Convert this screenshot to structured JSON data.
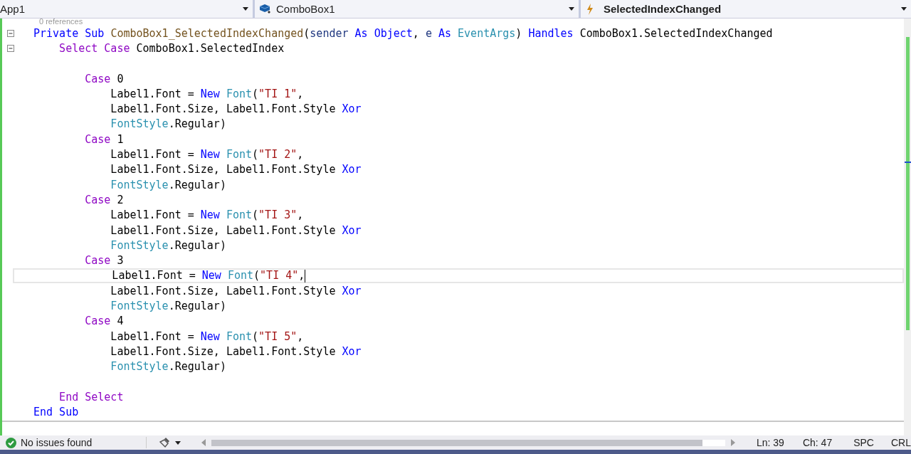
{
  "nav_bar": {
    "project": "App1",
    "object": "ComboBox1",
    "event": "SelectedIndexChanged"
  },
  "code_lens": "0 references",
  "lines": [
    {
      "kind": "code",
      "foldable": true,
      "current": false,
      "tokens": [
        {
          "text": "Private Sub ",
          "kind": "keyword"
        },
        {
          "text": "ComboBox1_SelectedIndexChanged",
          "kind": "method"
        },
        {
          "text": "(",
          "kind": "plain"
        },
        {
          "text": "sender",
          "kind": "param"
        },
        {
          "text": " As Object",
          "kind": "keyword"
        },
        {
          "text": ", ",
          "kind": "plain"
        },
        {
          "text": "e",
          "kind": "param"
        },
        {
          "text": " As ",
          "kind": "keyword"
        },
        {
          "text": "EventArgs",
          "kind": "type"
        },
        {
          "text": ") ",
          "kind": "plain"
        },
        {
          "text": "Handles",
          "kind": "keyword"
        },
        {
          "text": " ComboBox1.SelectedIndexChanged",
          "kind": "plain"
        }
      ]
    },
    {
      "kind": "code",
      "foldable": true,
      "current": false,
      "tokens": [
        {
          "text": "    Select Case",
          "kind": "control"
        },
        {
          "text": " ComboBox1.SelectedIndex",
          "kind": "plain"
        }
      ]
    },
    {
      "kind": "blank",
      "foldable": false,
      "current": false
    },
    {
      "kind": "code",
      "foldable": false,
      "current": false,
      "tokens": [
        {
          "text": "        Case",
          "kind": "control"
        },
        {
          "text": " 0",
          "kind": "plain"
        }
      ]
    },
    {
      "kind": "code",
      "foldable": false,
      "current": false,
      "tokens": [
        {
          "text": "            Label1.Font = ",
          "kind": "plain"
        },
        {
          "text": "New ",
          "kind": "keyword"
        },
        {
          "text": "Font",
          "kind": "type"
        },
        {
          "text": "(",
          "kind": "plain"
        },
        {
          "text": "\"TI 1\"",
          "kind": "string"
        },
        {
          "text": ",",
          "kind": "plain"
        }
      ]
    },
    {
      "kind": "code",
      "foldable": false,
      "current": false,
      "tokens": [
        {
          "text": "            Label1.Font.Size, Label1.Font.Style ",
          "kind": "plain"
        },
        {
          "text": "Xor",
          "kind": "keyword"
        }
      ]
    },
    {
      "kind": "code",
      "foldable": false,
      "current": false,
      "tokens": [
        {
          "text": "            FontStyle",
          "kind": "type"
        },
        {
          "text": ".Regular)",
          "kind": "plain"
        }
      ]
    },
    {
      "kind": "code",
      "foldable": false,
      "current": false,
      "tokens": [
        {
          "text": "        Case",
          "kind": "control"
        },
        {
          "text": " 1",
          "kind": "plain"
        }
      ]
    },
    {
      "kind": "code",
      "foldable": false,
      "current": false,
      "tokens": [
        {
          "text": "            Label1.Font = ",
          "kind": "plain"
        },
        {
          "text": "New ",
          "kind": "keyword"
        },
        {
          "text": "Font",
          "kind": "type"
        },
        {
          "text": "(",
          "kind": "plain"
        },
        {
          "text": "\"TI 2\"",
          "kind": "string"
        },
        {
          "text": ",",
          "kind": "plain"
        }
      ]
    },
    {
      "kind": "code",
      "foldable": false,
      "current": false,
      "tokens": [
        {
          "text": "            Label1.Font.Size, Label1.Font.Style ",
          "kind": "plain"
        },
        {
          "text": "Xor",
          "kind": "keyword"
        }
      ]
    },
    {
      "kind": "code",
      "foldable": false,
      "current": false,
      "tokens": [
        {
          "text": "            FontStyle",
          "kind": "type"
        },
        {
          "text": ".Regular)",
          "kind": "plain"
        }
      ]
    },
    {
      "kind": "code",
      "foldable": false,
      "current": false,
      "tokens": [
        {
          "text": "        Case",
          "kind": "control"
        },
        {
          "text": " 2",
          "kind": "plain"
        }
      ]
    },
    {
      "kind": "code",
      "foldable": false,
      "current": false,
      "tokens": [
        {
          "text": "            Label1.Font = ",
          "kind": "plain"
        },
        {
          "text": "New ",
          "kind": "keyword"
        },
        {
          "text": "Font",
          "kind": "type"
        },
        {
          "text": "(",
          "kind": "plain"
        },
        {
          "text": "\"TI 3\"",
          "kind": "string"
        },
        {
          "text": ",",
          "kind": "plain"
        }
      ]
    },
    {
      "kind": "code",
      "foldable": false,
      "current": false,
      "tokens": [
        {
          "text": "            Label1.Font.Size, Label1.Font.Style ",
          "kind": "plain"
        },
        {
          "text": "Xor",
          "kind": "keyword"
        }
      ]
    },
    {
      "kind": "code",
      "foldable": false,
      "current": false,
      "tokens": [
        {
          "text": "            FontStyle",
          "kind": "type"
        },
        {
          "text": ".Regular)",
          "kind": "plain"
        }
      ]
    },
    {
      "kind": "code",
      "foldable": false,
      "current": false,
      "tokens": [
        {
          "text": "        Case",
          "kind": "control"
        },
        {
          "text": " 3",
          "kind": "plain"
        }
      ]
    },
    {
      "kind": "code",
      "foldable": false,
      "current": true,
      "tokens": [
        {
          "text": "            Label1.Font = ",
          "kind": "plain"
        },
        {
          "text": "New ",
          "kind": "keyword"
        },
        {
          "text": "Font",
          "kind": "type"
        },
        {
          "text": "(",
          "kind": "plain"
        },
        {
          "text": "\"TI 4\"",
          "kind": "string"
        },
        {
          "text": ",",
          "kind": "plain"
        }
      ]
    },
    {
      "kind": "code",
      "foldable": false,
      "current": false,
      "tokens": [
        {
          "text": "            Label1.Font.Size, Label1.Font.Style ",
          "kind": "plain"
        },
        {
          "text": "Xor",
          "kind": "keyword"
        }
      ]
    },
    {
      "kind": "code",
      "foldable": false,
      "current": false,
      "tokens": [
        {
          "text": "            FontStyle",
          "kind": "type"
        },
        {
          "text": ".Regular)",
          "kind": "plain"
        }
      ]
    },
    {
      "kind": "code",
      "foldable": false,
      "current": false,
      "tokens": [
        {
          "text": "        Case",
          "kind": "control"
        },
        {
          "text": " 4",
          "kind": "plain"
        }
      ]
    },
    {
      "kind": "code",
      "foldable": false,
      "current": false,
      "tokens": [
        {
          "text": "            Label1.Font = ",
          "kind": "plain"
        },
        {
          "text": "New ",
          "kind": "keyword"
        },
        {
          "text": "Font",
          "kind": "type"
        },
        {
          "text": "(",
          "kind": "plain"
        },
        {
          "text": "\"TI 5\"",
          "kind": "string"
        },
        {
          "text": ",",
          "kind": "plain"
        }
      ]
    },
    {
      "kind": "code",
      "foldable": false,
      "current": false,
      "tokens": [
        {
          "text": "            Label1.Font.Size, Label1.Font.Style ",
          "kind": "plain"
        },
        {
          "text": "Xor",
          "kind": "keyword"
        }
      ]
    },
    {
      "kind": "code",
      "foldable": false,
      "current": false,
      "tokens": [
        {
          "text": "            FontStyle",
          "kind": "type"
        },
        {
          "text": ".Regular)",
          "kind": "plain"
        }
      ]
    },
    {
      "kind": "blank",
      "foldable": false,
      "current": false
    },
    {
      "kind": "code",
      "foldable": false,
      "current": false,
      "tokens": [
        {
          "text": "    End Select",
          "kind": "control"
        }
      ]
    },
    {
      "kind": "code",
      "foldable": false,
      "current": false,
      "tokens": [
        {
          "text": "End Sub",
          "kind": "keyword"
        }
      ]
    }
  ],
  "status_bar": {
    "issues": "No issues found",
    "line": "Ln: 39",
    "column": "Ch: 47",
    "indent_mode": "SPC",
    "line_ending": "CRL"
  }
}
